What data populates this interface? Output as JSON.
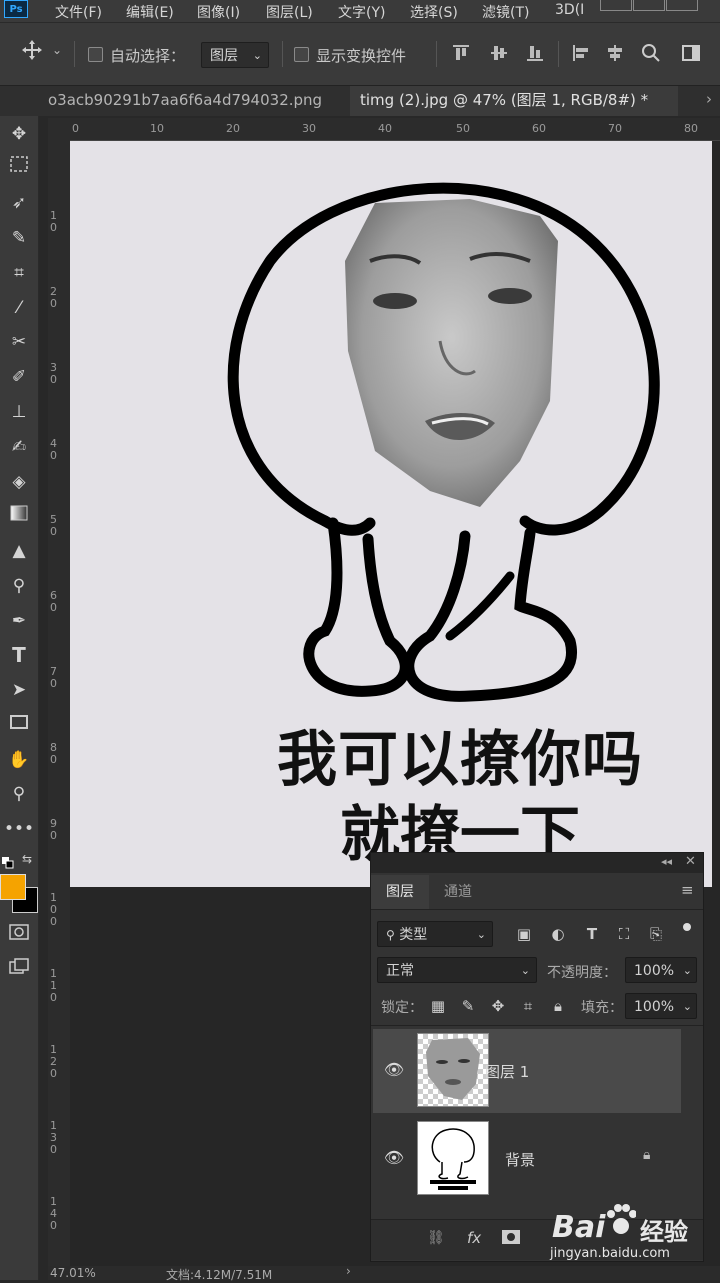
{
  "app": {
    "logo": "Ps"
  },
  "menu": [
    "文件(F)",
    "编辑(E)",
    "图像(I)",
    "图层(L)",
    "文字(Y)",
    "选择(S)",
    "滤镜(T)",
    "3D(I"
  ],
  "options": {
    "auto_select_label": "自动选择：",
    "auto_select_value": "图层",
    "show_transform_label": "显示变换控件"
  },
  "tabs": [
    {
      "label": "o3acb90291b7aa6f6a4d794032.png",
      "active": false
    },
    {
      "label": "timg (2).jpg @ 47% (图层 1, RGB/8#) *",
      "active": true
    }
  ],
  "ruler": {
    "h": [
      "0",
      "10",
      "20",
      "30",
      "40",
      "50",
      "60",
      "70",
      "80"
    ],
    "v": [
      "1\n0",
      "2\n0",
      "3\n0",
      "4\n0",
      "5\n0",
      "6\n0",
      "7\n0",
      "8\n0",
      "9\n0",
      "1\n0\n0",
      "1\n1\n0",
      "1\n2\n0",
      "1\n3\n0",
      "1\n4\n0"
    ]
  },
  "document": {
    "caption_line1": "我可以撩你吗",
    "caption_line2": "就撩一下"
  },
  "layers_panel": {
    "tab_layers": "图层",
    "tab_channels": "通道",
    "filter_kind": "类型",
    "blend_mode": "正常",
    "opacity_label": "不透明度：",
    "opacity_value": "100%",
    "lock_label": "锁定：",
    "fill_label": "填充：",
    "fill_value": "100%",
    "layers": [
      {
        "name": "图层 1",
        "selected": true,
        "locked": false
      },
      {
        "name": "背景",
        "selected": false,
        "locked": true
      }
    ],
    "bottom_icons": [
      "link-icon",
      "fx-icon",
      "mask-icon"
    ]
  },
  "status": {
    "zoom": "47.01%",
    "doc_info": "文档:4.12M/7.51M"
  },
  "watermark": {
    "brand": "Bai",
    "brand2": "经验",
    "url": "jingyan.baidu.com"
  },
  "colors": {
    "foreground": "#f5a300",
    "background": "#000000",
    "accent": "#31a8ff"
  }
}
